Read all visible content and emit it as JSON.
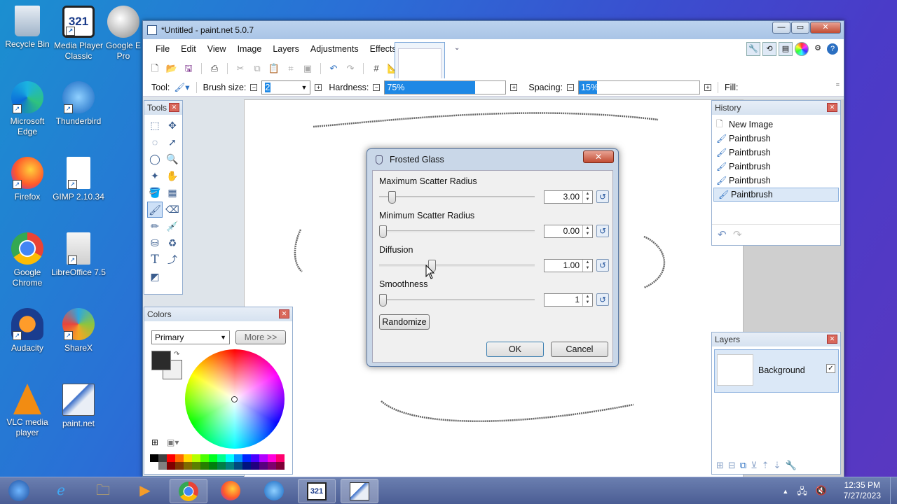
{
  "desktop": {
    "icons": [
      {
        "label": "Recycle Bin",
        "icon": "recycle-bin-icon"
      },
      {
        "label": "Media Player Classic",
        "icon": "media-player-icon"
      },
      {
        "label": "Google E Pro",
        "icon": "google-earth-icon"
      },
      {
        "label": "Microsoft Edge",
        "icon": "edge-icon"
      },
      {
        "label": "Thunderbird",
        "icon": "thunderbird-icon"
      },
      {
        "label": "Firefox",
        "icon": "firefox-icon"
      },
      {
        "label": "GIMP 2.10.34",
        "icon": "gimp-icon"
      },
      {
        "label": "Google Chrome",
        "icon": "chrome-icon"
      },
      {
        "label": "LibreOffice 7.5",
        "icon": "libreoffice-icon"
      },
      {
        "label": "Audacity",
        "icon": "audacity-icon"
      },
      {
        "label": "ShareX",
        "icon": "sharex-icon"
      },
      {
        "label": "VLC media player",
        "icon": "vlc-icon"
      },
      {
        "label": "paint.net",
        "icon": "paintnet-icon"
      }
    ]
  },
  "window": {
    "title": "*Untitled - paint.net 5.0.7",
    "controls": {
      "minimize": "—",
      "maximize": "▭",
      "close": "✕"
    }
  },
  "menu": [
    "File",
    "Edit",
    "View",
    "Image",
    "Layers",
    "Adjustments",
    "Effects"
  ],
  "toolbar": {
    "tool_label": "Tool:",
    "brush_size_label": "Brush size:",
    "brush_size_value": "2",
    "hardness_label": "Hardness:",
    "hardness_value": "75%",
    "hardness_fraction": 0.75,
    "spacing_label": "Spacing:",
    "spacing_value": "15%",
    "spacing_fraction": 0.15,
    "fill_label": "Fill:"
  },
  "tools_panel": {
    "title": "Tools"
  },
  "colors_panel": {
    "title": "Colors",
    "mode": "Primary",
    "more_button": "More >>",
    "primary_color": "#2b2b2b",
    "secondary_color": "#f0f0f0"
  },
  "history_panel": {
    "title": "History",
    "items": [
      "New Image",
      "Paintbrush",
      "Paintbrush",
      "Paintbrush",
      "Paintbrush",
      "Paintbrush"
    ],
    "selected_index": 5
  },
  "layers_panel": {
    "title": "Layers",
    "layers": [
      {
        "name": "Background",
        "visible": true
      }
    ]
  },
  "dialog": {
    "title": "Frosted Glass",
    "properties": [
      {
        "label": "Maximum Scatter Radius",
        "value": "3.00",
        "fraction": 0.06
      },
      {
        "label": "Minimum Scatter Radius",
        "value": "0.00",
        "fraction": 0.0
      },
      {
        "label": "Diffusion",
        "value": "1.00",
        "fraction": 0.33
      },
      {
        "label": "Smoothness",
        "value": "1",
        "fraction": 0.0
      }
    ],
    "randomize_button": "Randomize",
    "ok_button": "OK",
    "cancel_button": "Cancel"
  },
  "taskbar": {
    "time": "12:35 PM",
    "date": "7/27/2023"
  }
}
